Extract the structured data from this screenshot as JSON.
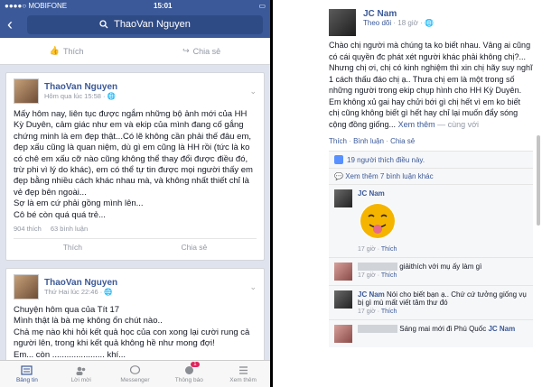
{
  "left": {
    "status": {
      "carrier": "●●●●○ MOBIFONE",
      "time": "15:01",
      "battery": "▭"
    },
    "search": {
      "query": "ThaoVan Nguyen"
    },
    "top_actions": {
      "like": "Thích",
      "share": "Chia sẻ"
    },
    "posts": [
      {
        "author": "ThaoVan Nguyen",
        "time": "Hôm qua lúc 15:58 · 🌐",
        "text": "Mấy hôm nay, liên tục được ngắm những bộ ảnh mới của HH Kỳ Duyên, cảm giác như em và ekip của mình đang cố gắng chứng minh là em đẹp thật...Có lẽ không cần phải thế đâu em, đẹp xấu cũng là quan niệm, dù gì em cũng là HH rồi (tức là ko có chê em xấu cỡ nào cũng không thể thay đổi được điều đó, trừ phi vì lý do khác), em có thể tự tin được mọi người thấy em đẹp bằng nhiều cách khác nhau mà, và không nhất thiết chỉ là vẻ đẹp bên ngoài...",
        "text2": "Sợ là em cứ phải gồng mình lên...",
        "text3": "Cô bé còn quá quá trẻ...",
        "likes": "904 thích",
        "comments": "63 bình luận"
      },
      {
        "author": "ThaoVan Nguyen",
        "time": "Thứ Hai lúc 22:46 · 🌐",
        "text": "Chuyện hôm qua của Tít 17",
        "text2": "Mình thật là bà mẹ không ổn chút nào..",
        "text3": "Chả mẹ nào khi hỏi kết quả học của con xong lại cười rung cả người lên, trong khi kết quả không hề như mong đợi!",
        "text4": "Em... còn ...................... khí..."
      }
    ],
    "tabs": [
      {
        "label": "Bảng tin",
        "icon": "news-feed-icon"
      },
      {
        "label": "Lời mời",
        "icon": "friend-requests-icon"
      },
      {
        "label": "Messenger",
        "icon": "messenger-icon"
      },
      {
        "label": "Thông báo",
        "icon": "notifications-icon",
        "badge": "1"
      },
      {
        "label": "Xem thêm",
        "icon": "more-icon"
      }
    ]
  },
  "right": {
    "author": "JC Nam",
    "follow": "Theo dõi",
    "time": "· 18 giờ ·",
    "body": "Chào chị người mà chúng ta ko biết nhau. Vâng ai cũng có cái quyền đc phát xét người khác phải không chị?... Nhưng chị ơi, chị có kinh nghiệm thì xin chị hãy suy nghĩ 1 cách thấu đáo chị ạ.. Thưa chị em là một trong số những người trong ekip chụp hình cho HH Kỳ Duyên. Em không xủ gai hay chửi bới gì chị hết vì em ko biết chị cũng không biết gì hết hay chỉ lại muốn đẩy sóng cộng đồng giống...",
    "see_more": "Xem thêm",
    "with": "— cùng với",
    "actions": {
      "like": "Thích",
      "comment": "Bình luận",
      "share": "Chia sẻ"
    },
    "likes": "19 người thích điều này.",
    "prev_comments": "Xem thêm 7 bình luận khác",
    "comments": [
      {
        "name": "JC Nam",
        "text": "",
        "time": "17 giờ",
        "like": "Thích"
      },
      {
        "name": "",
        "text": "giảithích với mụ ấy làm gì",
        "time": "17 giờ",
        "like": "Thích"
      },
      {
        "name": "JC Nam",
        "text": "Nói cho biết bạn ạ.. Chứ cứ tưởng giống vụ bị gì mù mất viết tâm thư đó",
        "time": "17 giờ",
        "like": "Thích"
      },
      {
        "name": "",
        "text": "Sáng mai mới đi Phú Quốc",
        "tag": "JC Nam",
        "time": "",
        "like": ""
      }
    ]
  }
}
